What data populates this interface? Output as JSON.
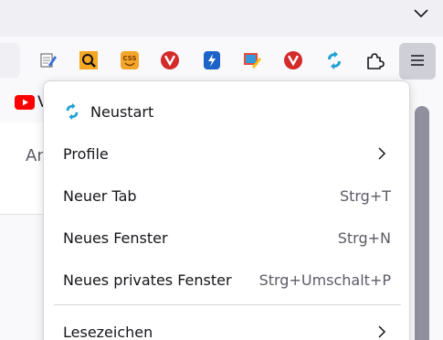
{
  "window": {
    "tabs_chevron_icon": "chevron-down-icon"
  },
  "toolbar": {
    "extensions": [
      {
        "name": "extension-edit-icon"
      },
      {
        "name": "extension-search-icon"
      },
      {
        "name": "extension-css-icon"
      },
      {
        "name": "extension-vivaldi-red-icon"
      },
      {
        "name": "extension-bolt-icon"
      },
      {
        "name": "extension-photo-edit-icon"
      },
      {
        "name": "extension-vivaldi-red-icon-2"
      },
      {
        "name": "extension-sync-icon"
      },
      {
        "name": "extensions-puzzle-icon"
      }
    ],
    "menu_icon": "hamburger-icon"
  },
  "bookmarks": {
    "first_label": "V"
  },
  "page": {
    "partial_text": "An"
  },
  "menu": {
    "items": [
      {
        "label": "Neustart",
        "icon": "restart-icon"
      },
      {
        "label": "Profile",
        "submenu": true
      },
      {
        "label": "Neuer Tab",
        "shortcut": "Strg+T"
      },
      {
        "label": "Neues Fenster",
        "shortcut": "Strg+N"
      },
      {
        "label": "Neues privates Fenster",
        "shortcut": "Strg+Umschalt+P"
      },
      {
        "label": "Lesezeichen",
        "submenu": true
      }
    ]
  },
  "colors": {
    "accent_restart": "#0ea5e9",
    "menu_button_active": "#cfcfd8",
    "youtube_red": "#ff0000"
  }
}
